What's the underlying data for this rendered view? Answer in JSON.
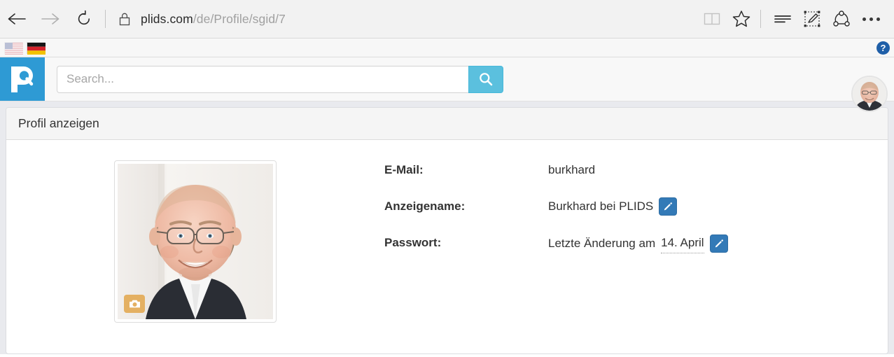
{
  "browser": {
    "back_label": "Back",
    "forward_label": "Forward",
    "refresh_label": "Refresh",
    "lock_label": "Site security",
    "url_host": "plids.com",
    "url_path": "/de/Profile/sgid/7",
    "icons": {
      "back": "back-arrow-icon",
      "forward": "forward-arrow-icon",
      "refresh": "refresh-icon",
      "lock": "lock-icon",
      "reading_view": "reading-view-icon",
      "favorites": "star-icon",
      "hub": "hub-icon",
      "web_note": "web-note-icon",
      "share": "share-icon",
      "more": "more-ellipsis-icon"
    }
  },
  "lang_bar": {
    "flags": [
      {
        "name": "flag-us",
        "title": "English",
        "active": false
      },
      {
        "name": "flag-de",
        "title": "Deutsch",
        "active": true
      }
    ],
    "help_label": "?"
  },
  "navbar": {
    "brand_label": "p",
    "brand_color": "#2e9ad4",
    "search": {
      "placeholder": "Search...",
      "value": "",
      "button_label": "search-icon",
      "button_color": "#5bc0de"
    },
    "avatar_label": "Burkhard"
  },
  "panel": {
    "title": "Profil anzeigen",
    "photo": {
      "alt": "Profilbild",
      "camera_button_label": "camera-icon",
      "camera_button_color": "#e4b062"
    },
    "details": [
      {
        "label": "E-Mail:",
        "value": "burkhard",
        "has_edit": false,
        "dotted": false
      },
      {
        "label": "Anzeigename:",
        "value": "Burkhard bei PLIDS",
        "has_edit": true,
        "dotted": false
      },
      {
        "label": "Passwort:",
        "value": "Letzte Änderung am",
        "value_dotted": "14. April",
        "has_edit": true,
        "dotted": true
      }
    ],
    "edit_button_color": "#337ab7",
    "edit_button_label": "pencil-icon"
  }
}
